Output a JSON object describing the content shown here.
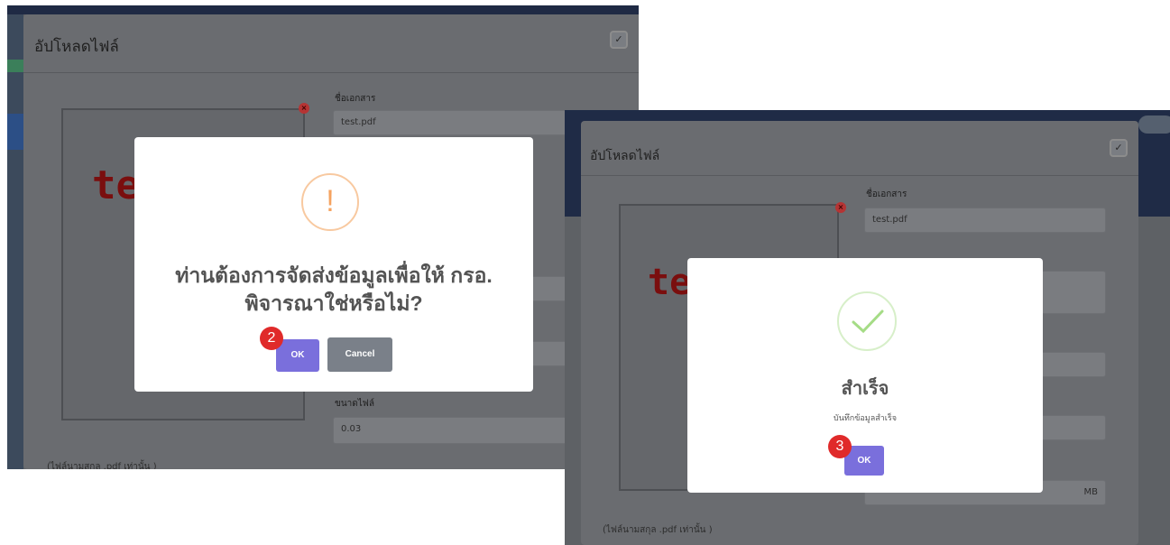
{
  "left_screenshot": {
    "modal_title": "อัปโหลดไฟล์",
    "preview_text": "te",
    "fields": [
      {
        "label": "ชื่อเอกสาร",
        "value": "test.pdf"
      },
      {
        "label": "ขนาดไฟล์",
        "value": "0.03"
      }
    ],
    "footer_note": "(ไฟล์นามสกุล .pdf เท่านั้น )",
    "dialog": {
      "title": "ท่านต้องการจัดส่งข้อมูลเพื่อให้ กรอ. พิจารณาใช่หรือไม่?",
      "ok_label": "OK",
      "cancel_label": "Cancel",
      "step": "2"
    }
  },
  "right_screenshot": {
    "modal_title": "อัปโหลดไฟล์",
    "preview_text": "te",
    "fields": [
      {
        "label": "ชื่อเอกสาร",
        "value": "test.pdf"
      }
    ],
    "unit": "MB",
    "footer_note": "(ไฟล์นามสกุล .pdf เท่านั้น )",
    "dialog": {
      "title": "สำเร็จ",
      "message": "บันทึกข้อมูลสำเร็จ",
      "ok_label": "OK",
      "step": "3"
    }
  },
  "colors": {
    "confirm_button": "#7a6fdc",
    "cancel_button": "#7a8089",
    "warning_icon": "#f5a360",
    "success_icon": "#a5dc86",
    "step_badge": "#e02a2a"
  },
  "icons": [
    "warning-icon",
    "success-check-icon",
    "close-icon",
    "remove-file-icon"
  ]
}
